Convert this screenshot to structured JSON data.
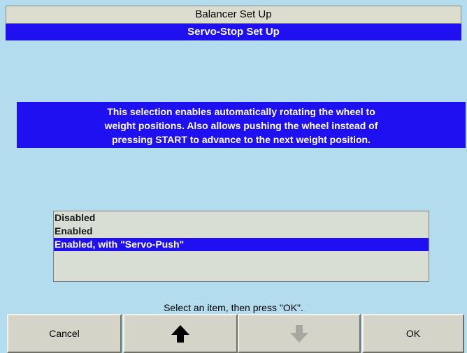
{
  "header": {
    "title": "Balancer Set Up",
    "subtitle": "Servo-Stop Set Up"
  },
  "info": {
    "lines": [
      "This selection enables automatically rotating the wheel to",
      "weight positions. Also allows pushing the wheel instead of",
      "pressing START to advance to the next weight position."
    ]
  },
  "options": {
    "items": [
      {
        "label": "Disabled",
        "selected": false
      },
      {
        "label": "Enabled",
        "selected": false
      },
      {
        "label": "Enabled, with \"Servo-Push\"",
        "selected": true
      }
    ]
  },
  "status": "Select an item, then press \"OK\".",
  "buttons": {
    "cancel": "Cancel",
    "up_icon": "arrow-up-icon",
    "down_icon": "arrow-down-icon",
    "ok": "OK"
  },
  "colors": {
    "background": "#b3dcee",
    "highlight": "#1f10f2",
    "disabled_arrow": "#a8a8a0"
  }
}
